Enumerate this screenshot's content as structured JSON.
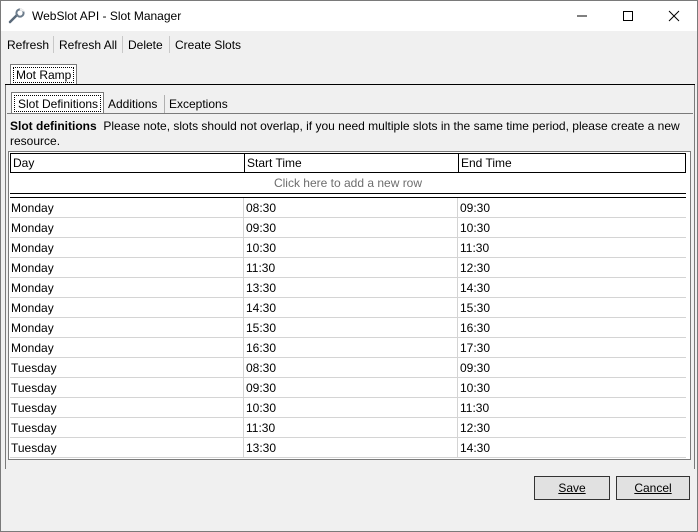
{
  "window": {
    "title": "WebSlot API - Slot Manager",
    "icon": "wrench-icon"
  },
  "toolbar": {
    "refresh_label": "Refresh",
    "refresh_all_label": "Refresh All",
    "delete_label": "Delete",
    "create_slots_label": "Create Slots"
  },
  "resource_tabs": [
    {
      "label": "Mot Ramp",
      "selected": true
    }
  ],
  "sub_tabs": [
    {
      "label": "Slot Definitions",
      "selected": true
    },
    {
      "label": "Additions",
      "selected": false
    },
    {
      "label": "Exceptions",
      "selected": false
    }
  ],
  "description": {
    "heading": "Slot definitions",
    "text": "Please note, slots should not overlap, if you need multiple slots in the same time period, please create a new resource."
  },
  "grid": {
    "columns": [
      "Day",
      "Start Time",
      "End Time"
    ],
    "new_row_hint": "Click here to add a new row",
    "rows": [
      [
        "Monday",
        "08:30",
        "09:30"
      ],
      [
        "Monday",
        "09:30",
        "10:30"
      ],
      [
        "Monday",
        "10:30",
        "11:30"
      ],
      [
        "Monday",
        "11:30",
        "12:30"
      ],
      [
        "Monday",
        "13:30",
        "14:30"
      ],
      [
        "Monday",
        "14:30",
        "15:30"
      ],
      [
        "Monday",
        "15:30",
        "16:30"
      ],
      [
        "Monday",
        "16:30",
        "17:30"
      ],
      [
        "Tuesday",
        "08:30",
        "09:30"
      ],
      [
        "Tuesday",
        "09:30",
        "10:30"
      ],
      [
        "Tuesday",
        "10:30",
        "11:30"
      ],
      [
        "Tuesday",
        "11:30",
        "12:30"
      ],
      [
        "Tuesday",
        "13:30",
        "14:30"
      ]
    ]
  },
  "footer": {
    "save_label": "Save",
    "cancel_label": "Cancel"
  }
}
